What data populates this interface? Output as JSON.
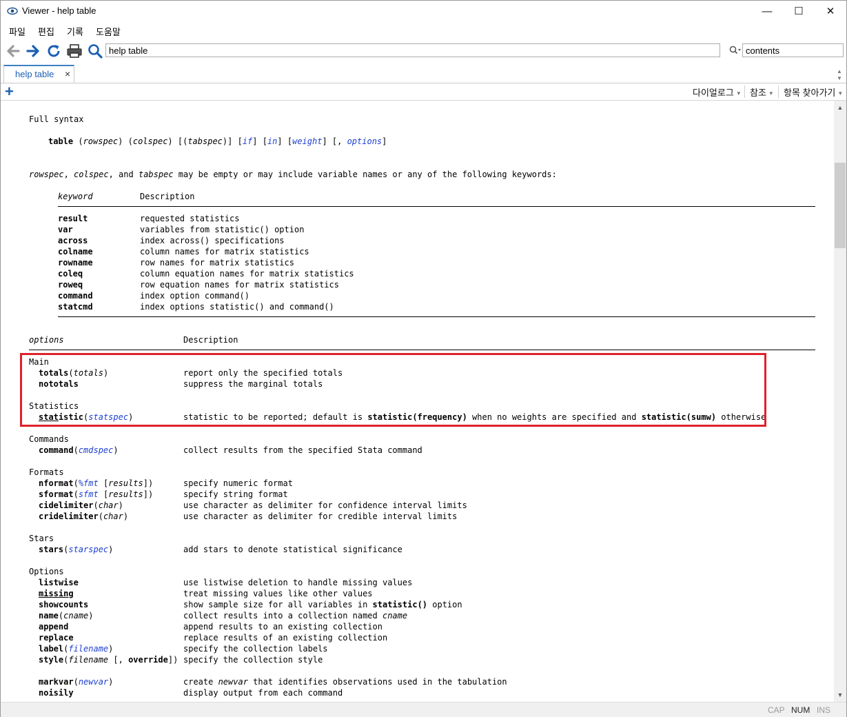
{
  "window": {
    "title": "Viewer - help table",
    "minimize": "—",
    "maximize": "☐",
    "close": "✕"
  },
  "menu": [
    "파일",
    "편집",
    "기록",
    "도움말"
  ],
  "toolbar": {
    "address": "help table",
    "search_value": "contents"
  },
  "tab": {
    "label": "help table",
    "close": "×"
  },
  "subbar": {
    "dialog": "다이얼로그",
    "see_also": "참조",
    "jump_to": "항목 찾아가기"
  },
  "status": {
    "cap": "CAP",
    "num": "NUM",
    "ins": "INS"
  },
  "content": {
    "full_syntax": "Full syntax",
    "syntax_line": {
      "cmd": "table",
      "rowspec": "rowspec",
      "colspec": "colspec",
      "tabspec": "tabspec",
      "if": "if",
      "in": "in",
      "weight": "weight",
      "options": "options"
    },
    "intro": {
      "rowspec": "rowspec",
      "colspec": "colspec",
      "tabspec": "tabspec",
      "rest": " may be empty or may include variable names or any of the following keywords:"
    },
    "kw_header": {
      "keyword": "keyword",
      "description": "Description"
    },
    "keywords": [
      {
        "k": "result",
        "d": "requested statistics"
      },
      {
        "k": "var",
        "d": "variables from statistic() option"
      },
      {
        "k": "across",
        "d": "index across() specifications"
      },
      {
        "k": "colname",
        "d": "column names for matrix statistics"
      },
      {
        "k": "rowname",
        "d": "row names for matrix statistics"
      },
      {
        "k": "coleq",
        "d": "column equation names for matrix statistics"
      },
      {
        "k": "roweq",
        "d": "row equation names for matrix statistics"
      },
      {
        "k": "command",
        "d": "index option command()"
      },
      {
        "k": "statcmd",
        "d": "index options statistic() and command()"
      }
    ],
    "opt_header": {
      "options": "options",
      "description": "Description"
    },
    "groups": {
      "main": "Main",
      "statistics": "Statistics",
      "commands": "Commands",
      "formats": "Formats",
      "stars": "Stars",
      "options": "Options"
    },
    "desc": {
      "totals": "report only the specified totals",
      "nototals": "suppress the marginal totals",
      "statistic": "statistic to be reported; default is statistic(frequency) when no weights are specified and statistic(sumw) otherwise",
      "command": "collect results from the specified Stata command",
      "nformat": "specify numeric format",
      "sformat": "specify string format",
      "cidelimiter": "use character as delimiter for confidence interval limits",
      "cridelimiter": "use character as delimiter for credible interval limits",
      "stars": "add stars to denote statistical significance",
      "listwise": "use listwise deletion to handle missing values",
      "missing": "treat missing values like other values",
      "showcounts": "show sample size for all variables in statistic() option",
      "name": "collect results into a collection named cname",
      "append": "append results to an existing collection",
      "replace": "replace results of an existing collection",
      "label": "specify the collection labels",
      "style": "specify the collection style",
      "markvar": "create newvar that identifies observations used in the tabulation",
      "noisily": "display output from each command"
    }
  }
}
